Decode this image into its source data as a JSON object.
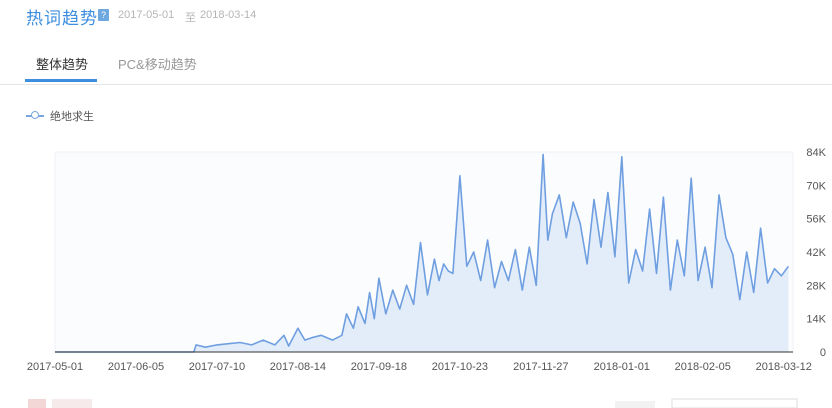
{
  "header": {
    "title": "热词趋势",
    "help_icon": "question-icon",
    "date_start": "2017-05-01",
    "date_sep": "至",
    "date_end": "2018-03-14"
  },
  "tabs": [
    {
      "label": "整体趋势",
      "active": true
    },
    {
      "label": "PC&移动趋势",
      "active": false
    }
  ],
  "colors": {
    "accent": "#3d8ede",
    "line": "#6f9fe0",
    "fill": "#e3edfa"
  },
  "chart_data": {
    "type": "line",
    "title": "",
    "xlabel": "",
    "ylabel": "",
    "series": [
      {
        "name": "绝地求生",
        "x": [
          "2017-05-01",
          "2017-05-31",
          "2017-06-30",
          "2017-07-01",
          "2017-07-05",
          "2017-07-10",
          "2017-07-15",
          "2017-07-20",
          "2017-07-25",
          "2017-07-30",
          "2017-08-04",
          "2017-08-08",
          "2017-08-10",
          "2017-08-14",
          "2017-08-17",
          "2017-08-20",
          "2017-08-24",
          "2017-08-29",
          "2017-09-02",
          "2017-09-04",
          "2017-09-07",
          "2017-09-09",
          "2017-09-12",
          "2017-09-14",
          "2017-09-16",
          "2017-09-18",
          "2017-09-21",
          "2017-09-24",
          "2017-09-27",
          "2017-09-30",
          "2017-10-03",
          "2017-10-06",
          "2017-10-09",
          "2017-10-12",
          "2017-10-14",
          "2017-10-16",
          "2017-10-18",
          "2017-10-20",
          "2017-10-23",
          "2017-10-26",
          "2017-10-29",
          "2017-11-01",
          "2017-11-04",
          "2017-11-07",
          "2017-11-10",
          "2017-11-13",
          "2017-11-16",
          "2017-11-19",
          "2017-11-22",
          "2017-11-25",
          "2017-11-28",
          "2017-11-30",
          "2017-12-02",
          "2017-12-05",
          "2017-12-08",
          "2017-12-11",
          "2017-12-14",
          "2017-12-17",
          "2017-12-20",
          "2017-12-23",
          "2017-12-26",
          "2017-12-29",
          "2018-01-01",
          "2018-01-04",
          "2018-01-07",
          "2018-01-10",
          "2018-01-13",
          "2018-01-16",
          "2018-01-19",
          "2018-01-22",
          "2018-01-25",
          "2018-01-28",
          "2018-01-31",
          "2018-02-03",
          "2018-02-06",
          "2018-02-09",
          "2018-02-12",
          "2018-02-15",
          "2018-02-18",
          "2018-02-21",
          "2018-02-24",
          "2018-02-27",
          "2018-03-02",
          "2018-03-05",
          "2018-03-08",
          "2018-03-11",
          "2018-03-14"
        ],
        "values": [
          0,
          0,
          0,
          3000,
          2000,
          3000,
          3500,
          4000,
          3000,
          5000,
          3000,
          7000,
          2500,
          10000,
          5000,
          6000,
          7000,
          5000,
          7000,
          16000,
          10000,
          19000,
          12000,
          25000,
          14000,
          31000,
          16000,
          26000,
          18000,
          28000,
          20000,
          46000,
          24000,
          39000,
          30000,
          37000,
          34000,
          33000,
          74000,
          36000,
          42000,
          30000,
          47000,
          27000,
          38000,
          30000,
          43000,
          26000,
          44000,
          28000,
          83000,
          47000,
          58000,
          66000,
          48000,
          63000,
          54000,
          37000,
          64000,
          44000,
          67000,
          40000,
          82000,
          29000,
          43000,
          34000,
          60000,
          33000,
          65000,
          26000,
          47000,
          32000,
          73000,
          30000,
          44000,
          27000,
          66000,
          48000,
          41000,
          22000,
          42000,
          25000,
          52000,
          29000,
          35000,
          32000,
          36000
        ]
      }
    ],
    "x_ticks": [
      "2017-05-01",
      "2017-06-05",
      "2017-07-10",
      "2017-08-14",
      "2017-09-18",
      "2017-10-23",
      "2017-11-27",
      "2018-01-01",
      "2018-02-05",
      "2018-03-12"
    ],
    "y_ticks": [
      0,
      14000,
      28000,
      42000,
      56000,
      70000,
      84000
    ],
    "y_tick_labels": [
      "0",
      "14K",
      "28K",
      "42K",
      "56K",
      "70K",
      "84K"
    ],
    "ylim": [
      0,
      84000
    ],
    "y_axis_side": "right",
    "legend": "top-left",
    "grid": false
  }
}
